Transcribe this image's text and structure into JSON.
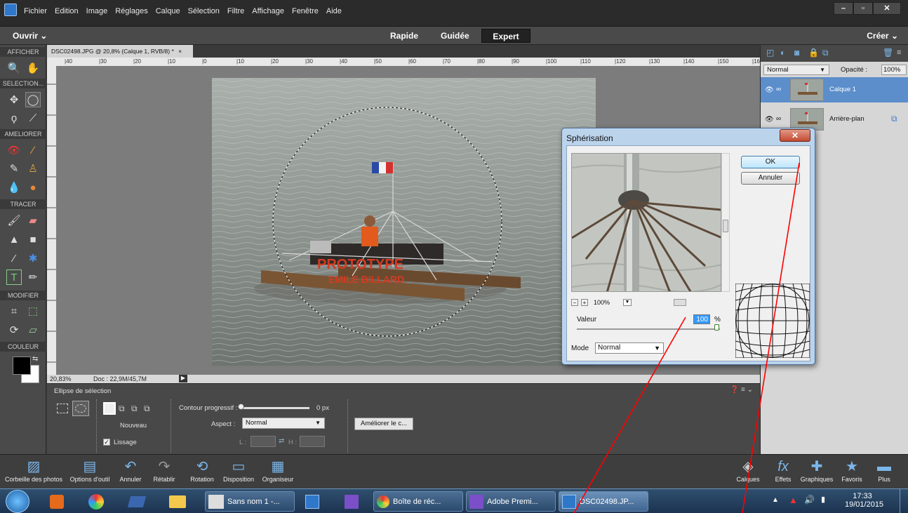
{
  "menubar": {
    "items": [
      "Fichier",
      "Edition",
      "Image",
      "Réglages",
      "Calque",
      "Sélection",
      "Filtre",
      "Affichage",
      "Fenêtre",
      "Aide"
    ],
    "min": "–",
    "max": "▫",
    "close": "✕"
  },
  "modebar": {
    "open": "Ouvrir",
    "rapide": "Rapide",
    "guidee": "Guidée",
    "expert": "Expert",
    "create": "Créer"
  },
  "left": {
    "afficher": "AFFICHER",
    "selection": "SELECTION...",
    "ameliorer": "AMELIORER",
    "tracer": "TRACER",
    "modifier": "MODIFIER",
    "couleur": "COULEUR"
  },
  "document": {
    "tab_title": "DSC02498.JPG @ 20,8% (Calque 1, RVB/8) *",
    "tab_close": "×",
    "ruler_labels": [
      "|40",
      "|30",
      "|20",
      "|10",
      "|0",
      "|10",
      "|20",
      "|30",
      "|40",
      "|50",
      "|60",
      "|70",
      "|80",
      "|90",
      "|100",
      "|110",
      "|120",
      "|130",
      "|140",
      "|150",
      "|16"
    ],
    "photo": {
      "text1": "PROTOTYPE",
      "text2": "EMILE BILLARD"
    }
  },
  "status": {
    "zoom": "20,83%",
    "doc": "Doc : 22,9M/45,7M"
  },
  "options": {
    "title": "Ellipse de sélection",
    "nouveau": "Nouveau",
    "lissage": "Lissage",
    "contour": "Contour progressif :",
    "contour_value": "0 px",
    "aspect_label": "Aspect :",
    "aspect_value": "Normal",
    "l_label": "L :",
    "h_label": "H :",
    "ameliorer": "Améliorer le c..."
  },
  "layers": {
    "blend": "Normal",
    "opacity_label": "Opacité :",
    "opacity_value": "100%",
    "items": [
      {
        "name": "Calque 1"
      },
      {
        "name": "Arrière-plan"
      }
    ]
  },
  "dialog": {
    "title": "Sphérisation",
    "close": "✕",
    "ok": "OK",
    "cancel": "Annuler",
    "zoom": "100%",
    "value_label": "Valeur",
    "value": "100",
    "percent": "%",
    "mode_label": "Mode",
    "mode_value": "Normal"
  },
  "bottombar": {
    "items": [
      "Corbeille des photos",
      "Options d'outil",
      "Annuler",
      "Rétablir",
      "Rotation",
      "Disposition",
      "Organiseur"
    ],
    "right_items": [
      "Calques",
      "Effets",
      "Graphiques",
      "Favoris",
      "Plus"
    ]
  },
  "taskbar": {
    "t1": "Sans nom 1 -...",
    "t2": "Boîte de réc...",
    "t3": "Adobe Premi...",
    "t4": "DSC02498.JP...",
    "time": "17:33",
    "date": "19/01/2015"
  },
  "colors": {
    "accent": "#2f77c9",
    "layer_selected": "#5b8ecb",
    "annotation": "#ff0000"
  }
}
